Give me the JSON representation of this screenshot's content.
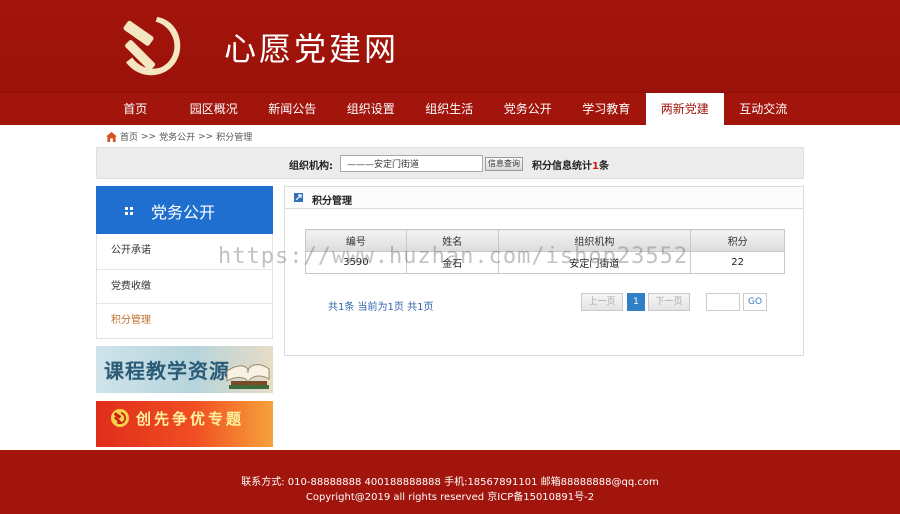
{
  "site": {
    "title": "心愿党建网"
  },
  "nav": {
    "items": [
      {
        "label": "首页"
      },
      {
        "label": "园区概况"
      },
      {
        "label": "新闻公告"
      },
      {
        "label": "组织设置"
      },
      {
        "label": "组织生活"
      },
      {
        "label": "党务公开"
      },
      {
        "label": "学习教育"
      },
      {
        "label": "两新党建",
        "active": true
      },
      {
        "label": "互动交流"
      }
    ]
  },
  "breadcrumb": {
    "home": "首页",
    "sep1": ">>",
    "section": "党务公开",
    "sep2": ">>",
    "current": "积分管理"
  },
  "filter": {
    "label": "组织机构:",
    "input_value": "———安定门街道",
    "search_button": "信息查询",
    "stats_prefix": "积分信息统计",
    "stats_count": "1",
    "stats_suffix": "条"
  },
  "sidebar": {
    "title": "党务公开",
    "items": [
      {
        "label": "公开承诺"
      },
      {
        "label": "党费收缴"
      },
      {
        "label": "积分管理",
        "active": true
      }
    ],
    "banner1_text": "课程教学资源",
    "banner2_text": "创先争优专题"
  },
  "panel": {
    "title": "积分管理",
    "table": {
      "headers": [
        "编号",
        "姓名",
        "组织机构",
        "积分"
      ],
      "rows": [
        [
          "3590",
          "金石",
          "安定门街道",
          "22"
        ]
      ]
    },
    "pager": {
      "summary": "共1条 当前为1页 共1页",
      "prev": "上一页",
      "current": "1",
      "next": "下一页",
      "go": "GO"
    }
  },
  "footer": {
    "line1": "联系方式: 010-88888888 400188888888 手机:18567891101 邮箱88888888@qq.com",
    "line2": "Copyright@2019 all rights reserved 京ICP备15010891号-2"
  },
  "watermark": "https://www.huzhan.com/ishop23552",
  "colors": {
    "brand_red": "#a1150d",
    "sidebar_blue": "#1e6fcf",
    "active_orange": "#c0712a",
    "pager_blue": "#2f80c6"
  }
}
